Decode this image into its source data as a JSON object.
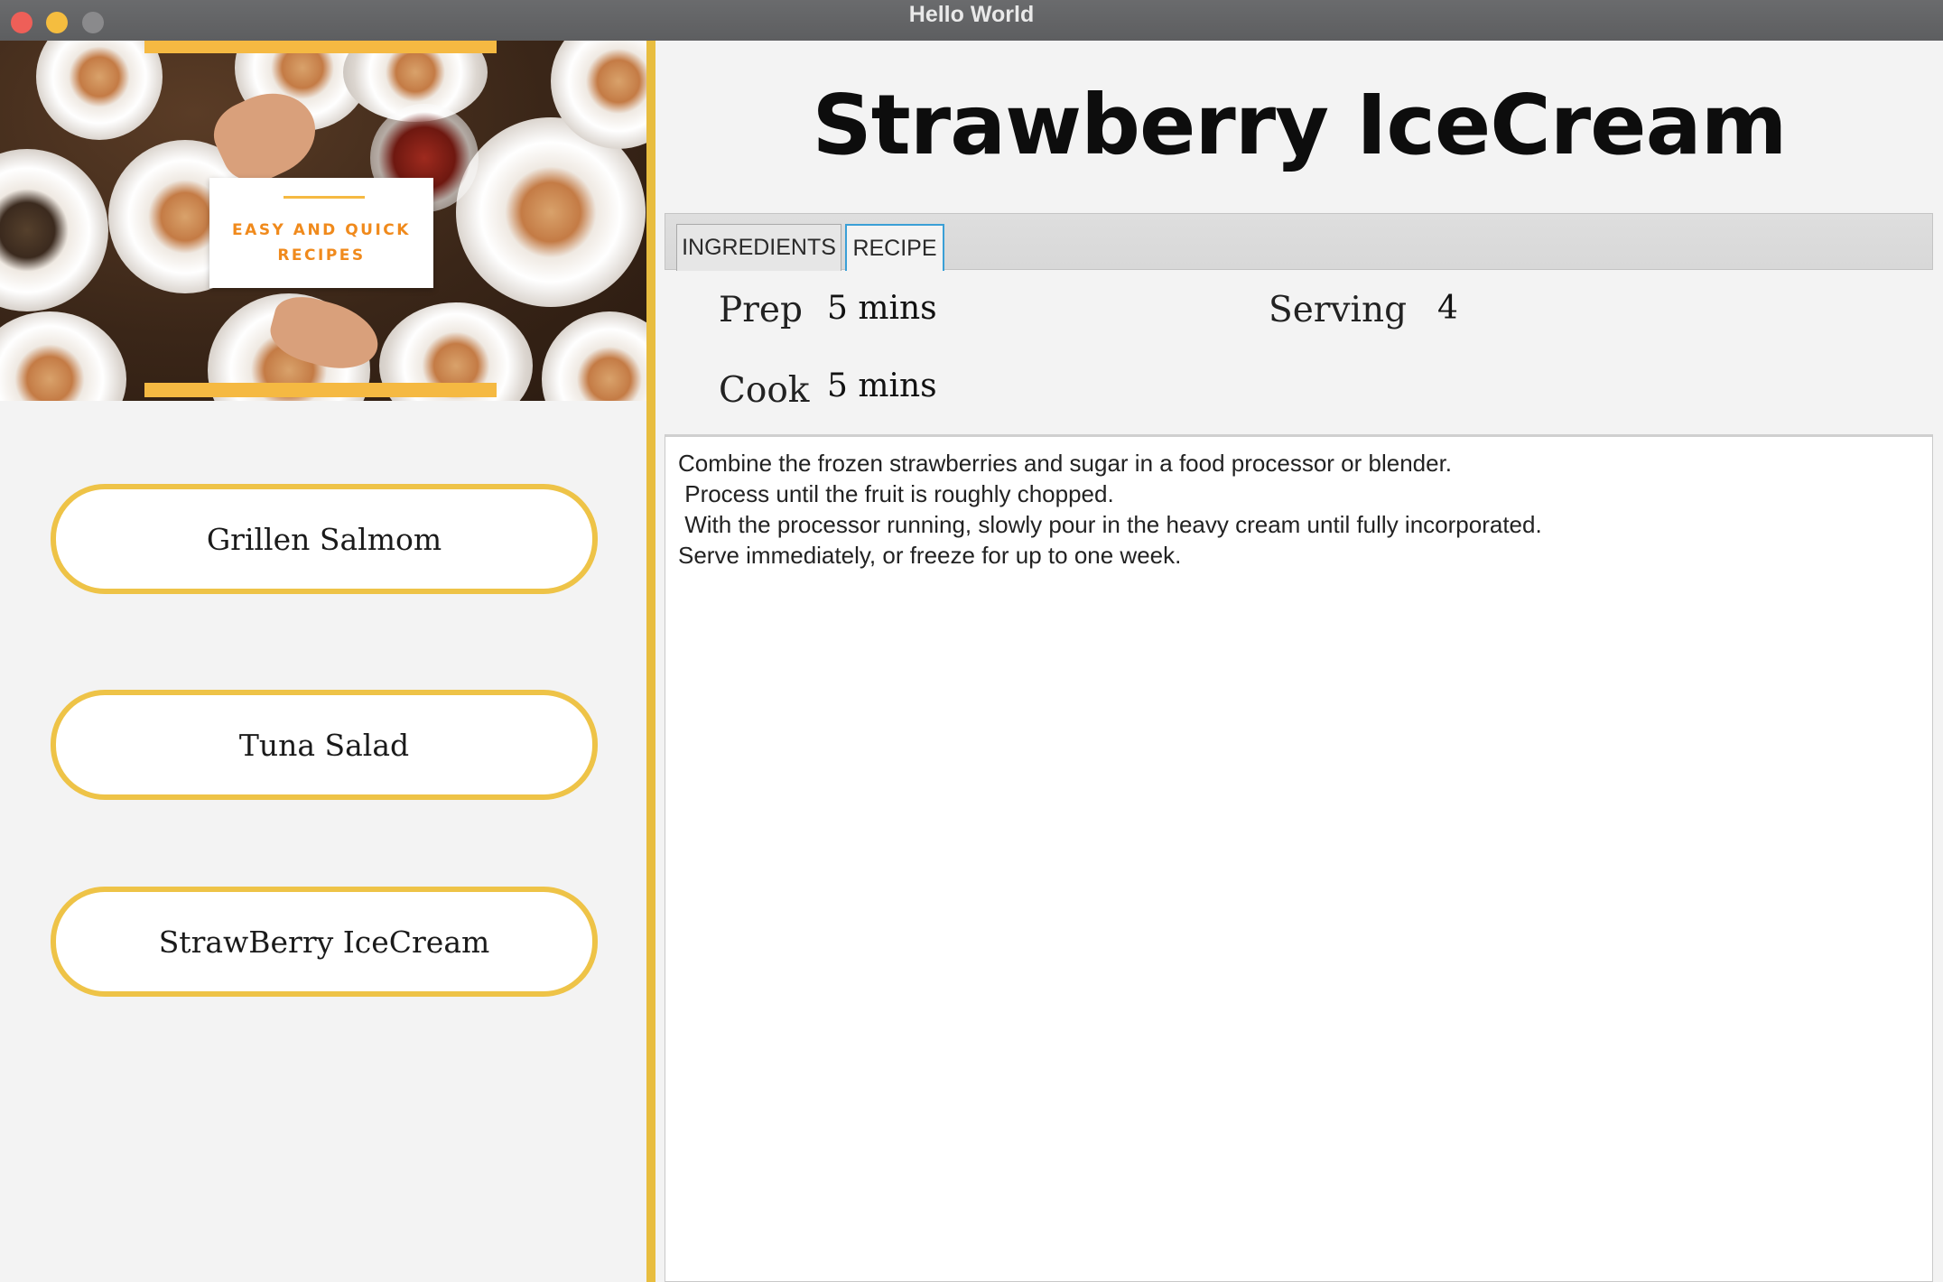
{
  "window": {
    "title": "Hello World"
  },
  "sidebar": {
    "banner": {
      "badge_line1": "EASY AND QUICK",
      "badge_line2": "RECIPES"
    },
    "recipes": [
      {
        "label": "Grillen Salmom"
      },
      {
        "label": "Tuna Salad"
      },
      {
        "label": "StrawBerry IceCream"
      }
    ]
  },
  "main": {
    "title": "Strawberry IceCream",
    "tabs": [
      {
        "label": "INGREDIENTS"
      },
      {
        "label": "RECIPE"
      }
    ],
    "selected_tab": "RECIPE",
    "meta": {
      "prep_label": "Prep",
      "prep_value": "5 mins",
      "serving_label": "Serving",
      "serving_value": "4",
      "cook_label": "Cook",
      "cook_value": "5 mins"
    },
    "instructions": [
      "Combine the frozen strawberries and sugar in a food processor or blender.",
      " Process until the fruit is roughly chopped.",
      " With the processor running, slowly pour in the heavy cream until fully incorporated.",
      "Serve immediately, or freeze for up to one week."
    ]
  },
  "colors": {
    "accent_yellow": "#eec347",
    "tab_focus_blue": "#3a9fd6",
    "badge_orange": "#f08a1c"
  }
}
